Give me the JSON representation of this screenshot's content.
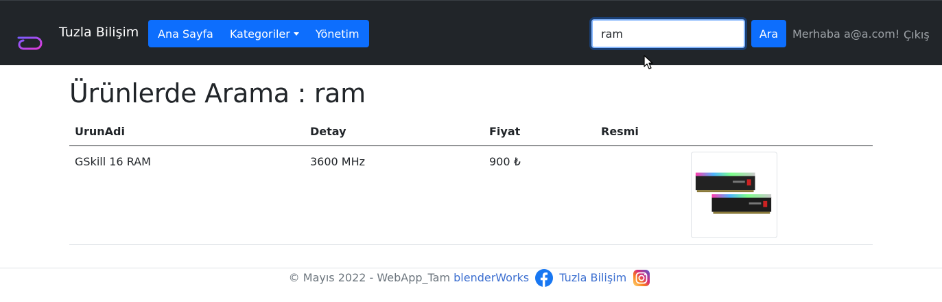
{
  "navbar": {
    "brand": "Tuzla Bilişim",
    "links": [
      "Ana Sayfa",
      "Kategoriler",
      "Yönetim"
    ],
    "search": {
      "value": "ram",
      "button_label": "Ara"
    },
    "greeting": "Merhaba a@a.com!",
    "logout": "Çıkış"
  },
  "main": {
    "title": "Ürünlerde Arama : ram",
    "columns": [
      "UrunAdi",
      "Detay",
      "Fiyat",
      "Resmi"
    ],
    "rows": [
      {
        "name": "GSkill 16 RAM",
        "detail": "3600 MHz",
        "price": "900 ₺"
      }
    ]
  },
  "footer": {
    "text": "© Mayıs 2022 - WebApp_Tam",
    "link1": "blenderWorks",
    "link2": "Tuzla Bilişim"
  },
  "icons": [
    "brand-logo-icon",
    "dropdown-caret-icon",
    "mouse-cursor-icon",
    "facebook-icon",
    "instagram-icon"
  ],
  "colors": {
    "navbar": "#212529",
    "primary": "#0d6efd",
    "link": "#3c6fd0"
  }
}
